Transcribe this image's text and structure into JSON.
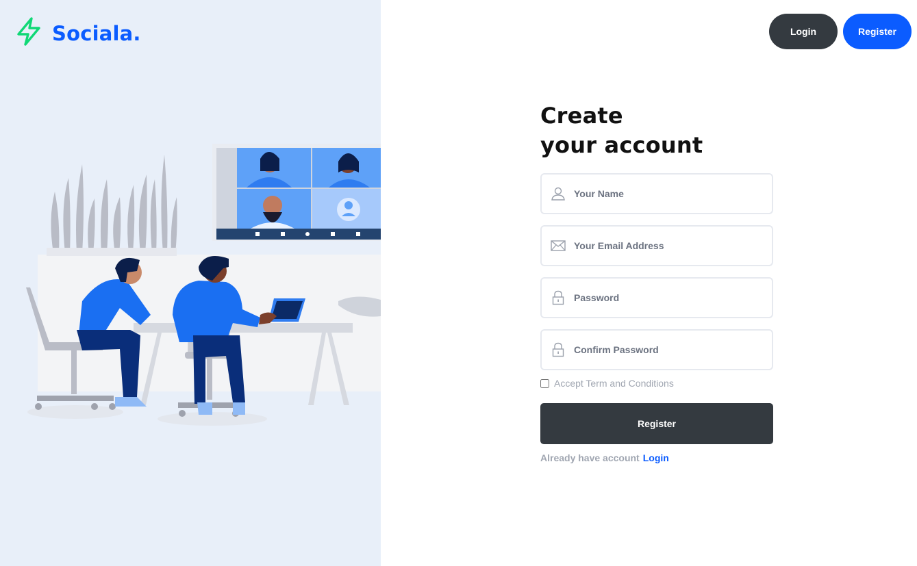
{
  "brand": {
    "name": "Sociala.",
    "accent_color": "#0b5cff",
    "icon": "bolt-icon",
    "icon_color": "#10d876"
  },
  "header": {
    "login_label": "Login",
    "register_label": "Register"
  },
  "form": {
    "title_line1": "Create",
    "title_line2": "your account",
    "fields": [
      {
        "placeholder": "Your Name",
        "icon": "user-icon",
        "value": ""
      },
      {
        "placeholder": "Your Email Address",
        "icon": "mail-icon",
        "value": ""
      },
      {
        "placeholder": "Password",
        "icon": "lock-icon",
        "value": ""
      },
      {
        "placeholder": "Confirm Password",
        "icon": "lock-icon",
        "value": ""
      }
    ],
    "terms_label": "Accept Term and Conditions",
    "terms_checked": false,
    "submit_label": "Register",
    "already_text": "Already have account",
    "login_link": "Login"
  },
  "colors": {
    "dark_button": "#343a40",
    "primary": "#0b5cff",
    "panel_bg": "#e8eff9"
  }
}
